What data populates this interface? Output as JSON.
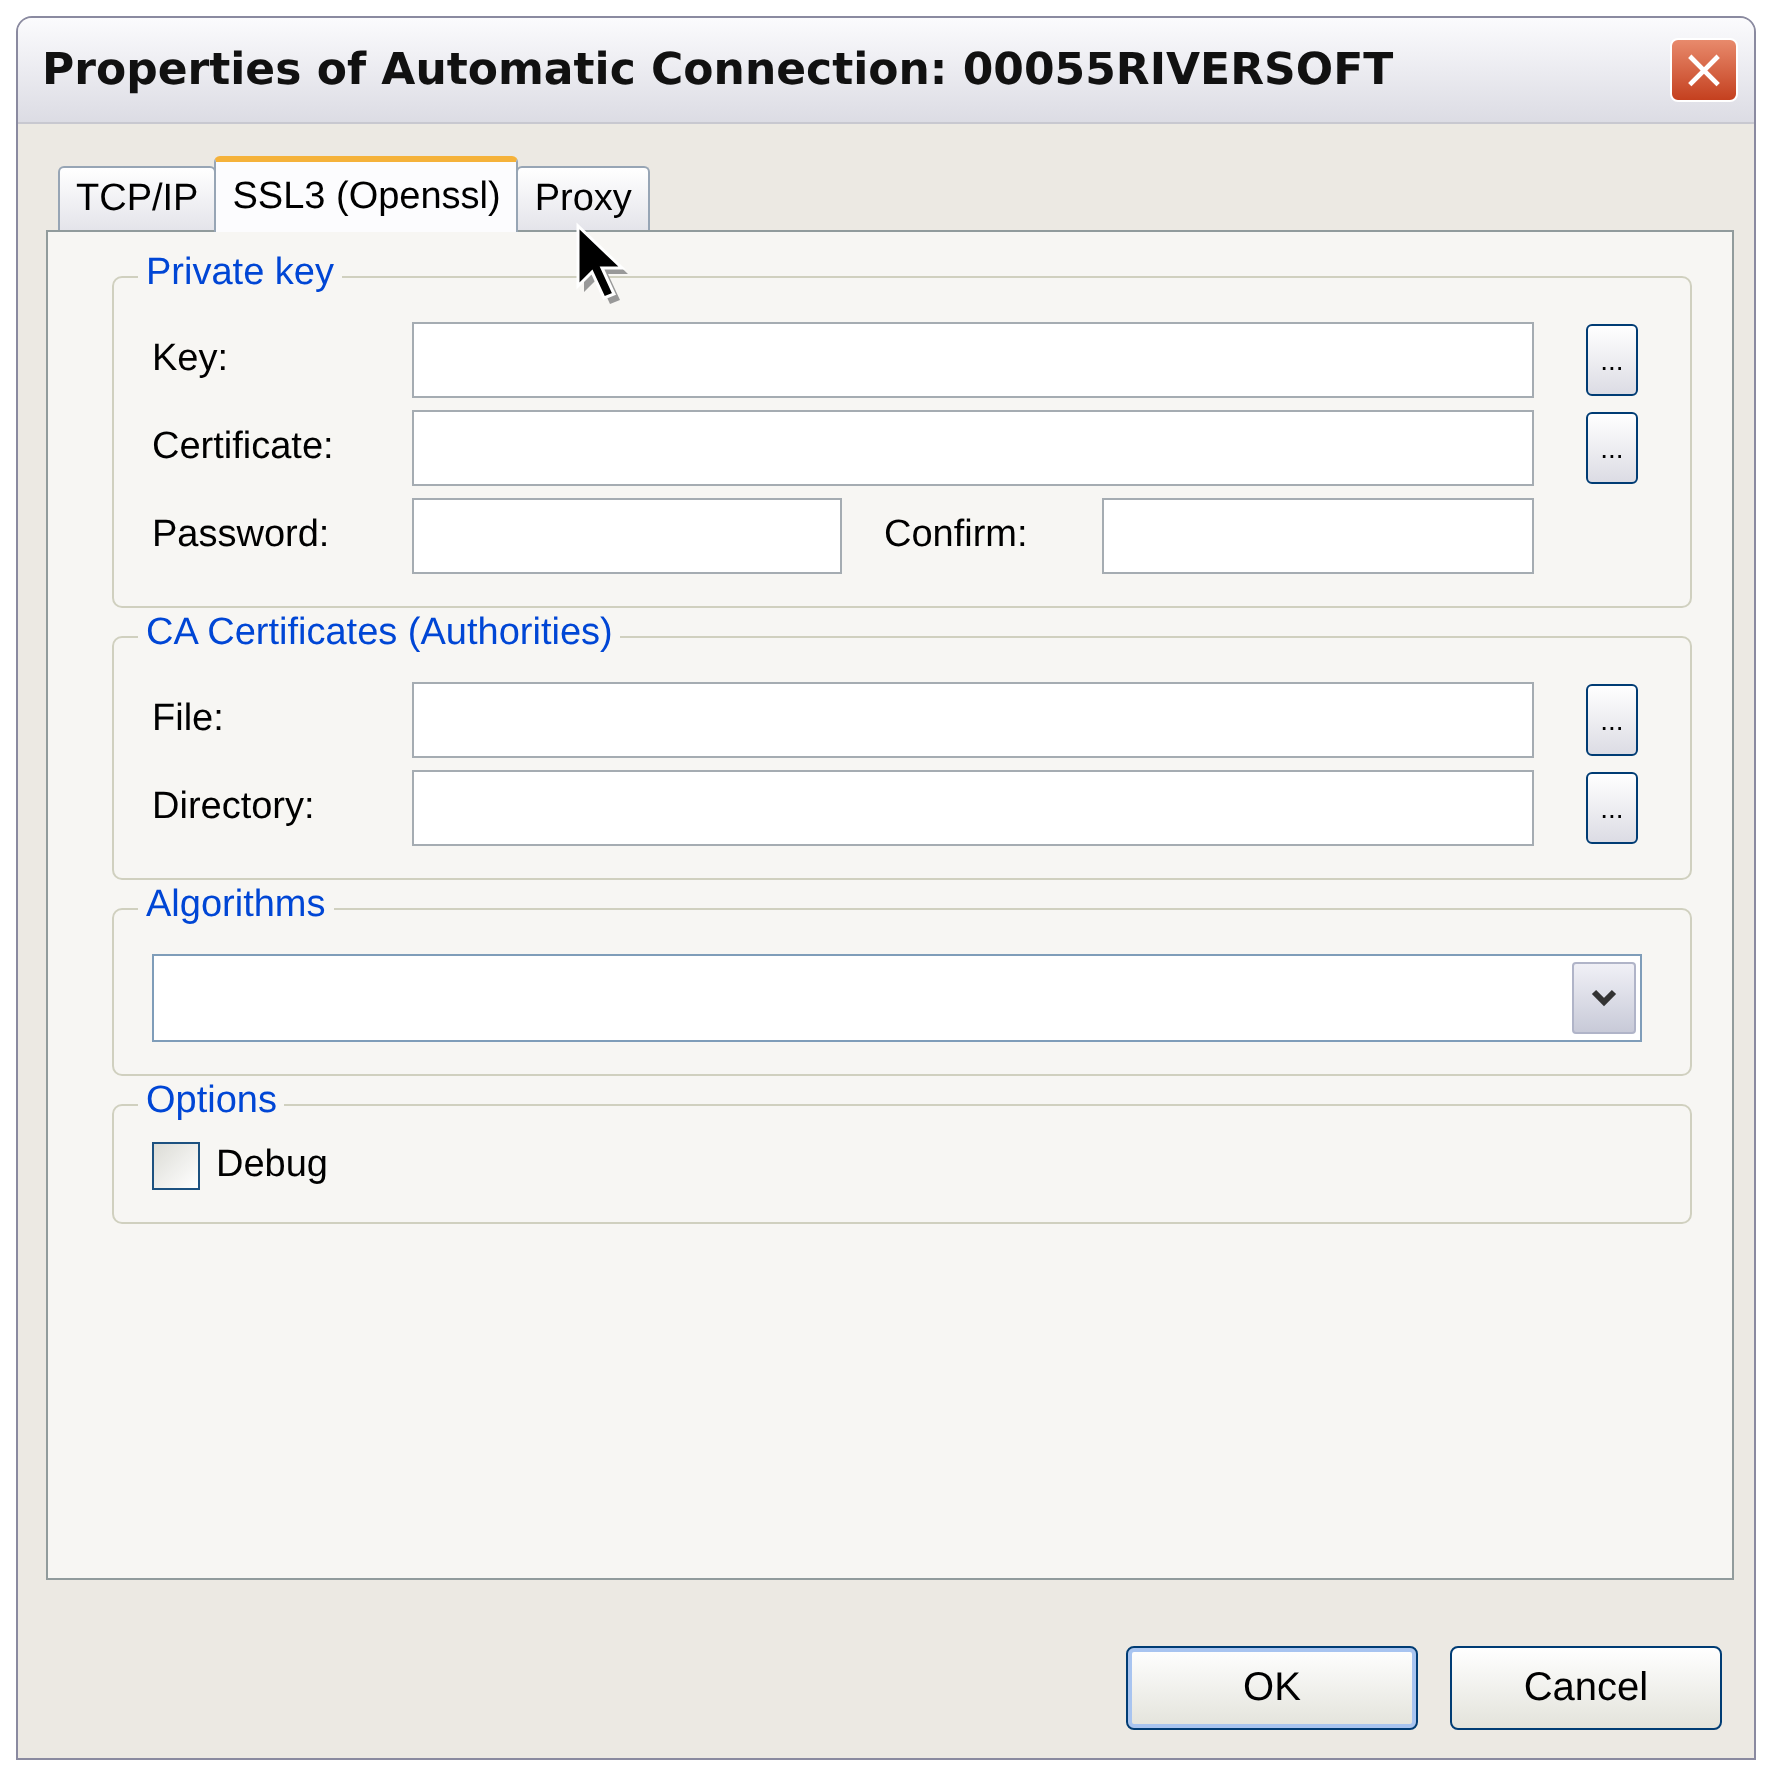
{
  "window": {
    "title": "Properties of Automatic Connection: 00055RIVERSOFT",
    "close": "×"
  },
  "tabs": [
    {
      "label": "TCP/IP",
      "selected": false
    },
    {
      "label": "SSL3 (Openssl)",
      "selected": true
    },
    {
      "label": "Proxy",
      "selected": false
    }
  ],
  "groups": [
    {
      "title": "Private key",
      "rows": [
        {
          "kind": "path",
          "label": "Key:",
          "browse": "..."
        },
        {
          "kind": "path",
          "label": "Certificate:",
          "browse": "..."
        },
        {
          "kind": "pair",
          "label": "Password:",
          "label_2": "Confirm:"
        }
      ]
    },
    {
      "title": "CA Certificates (Authorities)",
      "rows": [
        {
          "kind": "path",
          "label": "File:",
          "browse": "..."
        },
        {
          "kind": "path",
          "label": "Directory:",
          "browse": "..."
        }
      ]
    },
    {
      "title": "Algorithms",
      "rows": [
        {
          "kind": "select"
        }
      ]
    },
    {
      "title": "Options",
      "rows": [
        {
          "kind": "checkbox",
          "label": "Debug",
          "checked": false
        }
      ]
    }
  ],
  "buttons": [
    {
      "label": "OK",
      "default": true
    },
    {
      "label": "Cancel",
      "default": false
    }
  ]
}
